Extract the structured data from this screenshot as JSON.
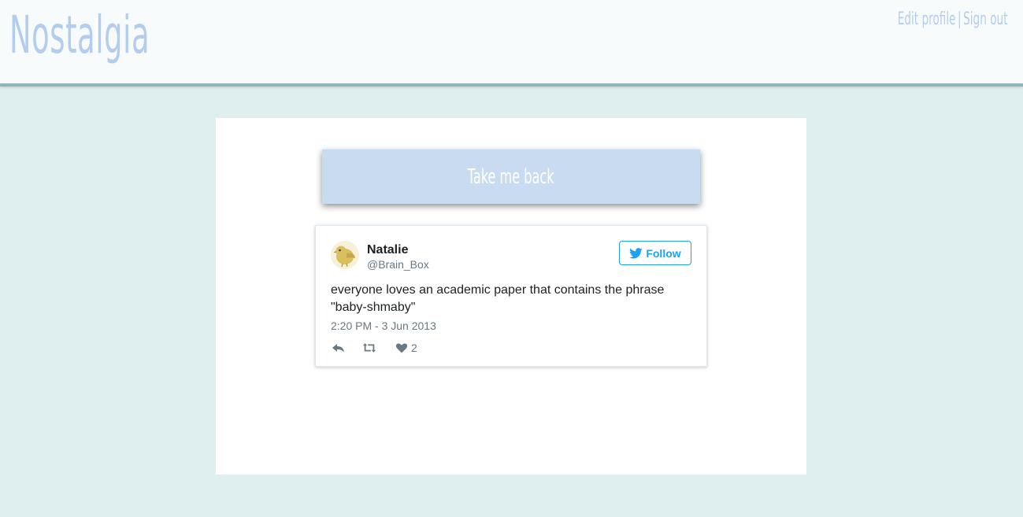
{
  "header": {
    "logo": "Nostalgia",
    "edit_profile": "Edit profile",
    "separator": "|",
    "sign_out": "Sign out"
  },
  "main": {
    "back_button": "Take me back"
  },
  "tweet": {
    "name": "Natalie",
    "handle": "@Brain_Box",
    "follow_label": "Follow",
    "text": "everyone loves an academic paper that contains the phrase \"baby-shmaby\"",
    "time": "2:20 PM - 3 Jun 2013",
    "like_count": "2"
  },
  "colors": {
    "background": "#dfeeee",
    "logo": "#b3cdee",
    "button": "#c8dbf1",
    "twitter_blue": "#1da1f2"
  },
  "icons": [
    "bird-avatar-icon",
    "twitter-bird-icon",
    "reply-icon",
    "retweet-icon",
    "heart-icon"
  ]
}
